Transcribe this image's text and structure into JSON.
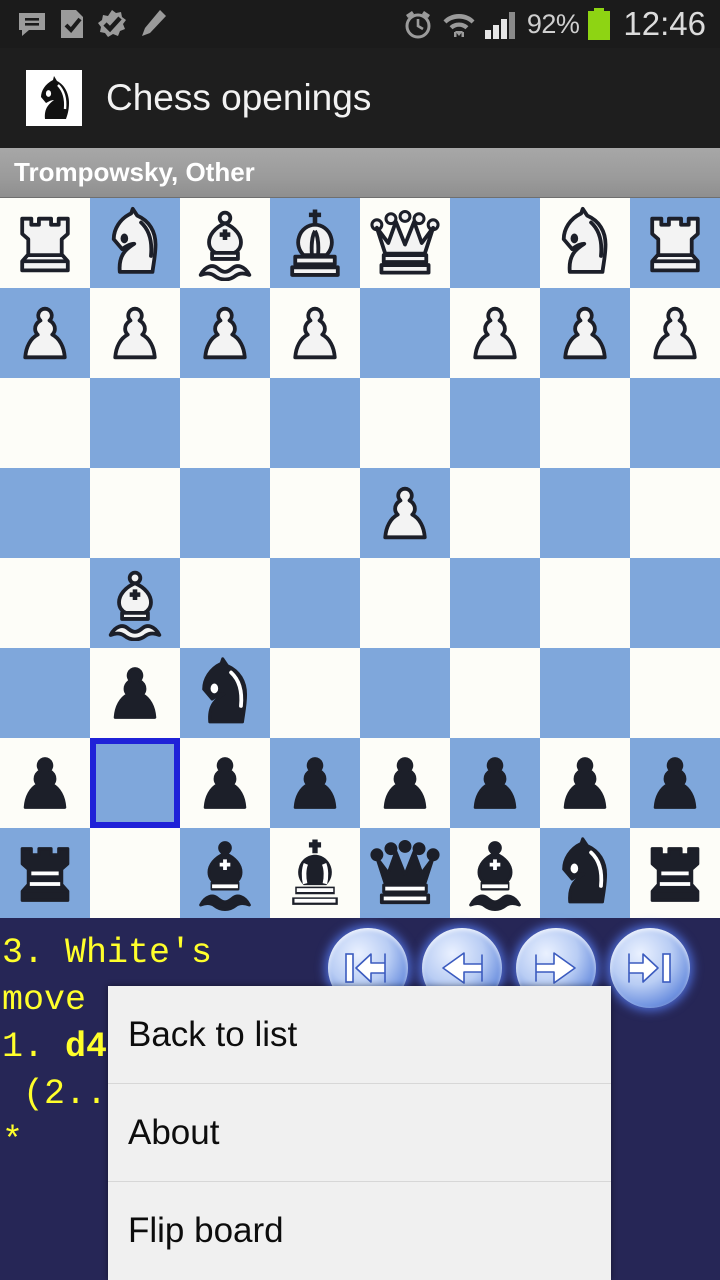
{
  "status_bar": {
    "left_icons": [
      "message-icon",
      "document-check-icon",
      "badge-check-icon",
      "pencil-icon"
    ],
    "alarm_icon": "alarm-icon",
    "wifi_icon": "wifi-icon",
    "signal_icon": "signal-bars-icon",
    "battery_percent": "92%",
    "battery_icon": "battery-icon",
    "battery_color": "#8ed413",
    "time": "12:46"
  },
  "action_bar": {
    "app_icon": "knight-app-icon",
    "title": "Chess openings"
  },
  "subtitle_bar": {
    "text": "Trompowsky, Other"
  },
  "board": {
    "light_square_color": "#fdfdf8",
    "dark_square_color": "#7fa7db",
    "highlight_color": "#1f22d8",
    "orientation": "black-at-bottom",
    "highlighted_square_index": 49,
    "squares": [
      "wR",
      "wN",
      "wB",
      "wK",
      "wQ",
      "",
      "wN",
      "wR",
      "wP",
      "wP",
      "wP",
      "wP",
      "",
      "wP",
      "wP",
      "wP",
      "",
      "",
      "",
      "",
      "",
      "",
      "",
      "",
      "",
      "",
      "",
      "",
      "wP",
      "",
      "",
      "",
      "",
      "wB",
      "",
      "",
      "",
      "",
      "",
      "",
      "",
      "bP",
      "bN",
      "",
      "",
      "",
      "",
      "",
      "bP",
      "",
      "bP",
      "bP",
      "bP",
      "bP",
      "bP",
      "bP",
      "bR",
      "",
      "bB",
      "bK",
      "bQ",
      "bB",
      "bN",
      "bR"
    ]
  },
  "move_pane": {
    "background_color": "#262656",
    "text_color": "#ffff2b",
    "line1": "3. White's",
    "line2": "move",
    "line3_prefix": "1. ",
    "line3_move": "d4",
    "line4": " (2..",
    "line5": "*"
  },
  "nav_buttons": [
    {
      "name": "first-move-button",
      "icon": "skip-to-start-icon"
    },
    {
      "name": "previous-move-button",
      "icon": "arrow-left-icon"
    },
    {
      "name": "next-move-button",
      "icon": "arrow-right-icon"
    },
    {
      "name": "last-move-button",
      "icon": "skip-to-end-icon"
    }
  ],
  "menu": {
    "items": [
      {
        "label": "Back to list"
      },
      {
        "label": "About"
      },
      {
        "label": "Flip board"
      }
    ]
  }
}
